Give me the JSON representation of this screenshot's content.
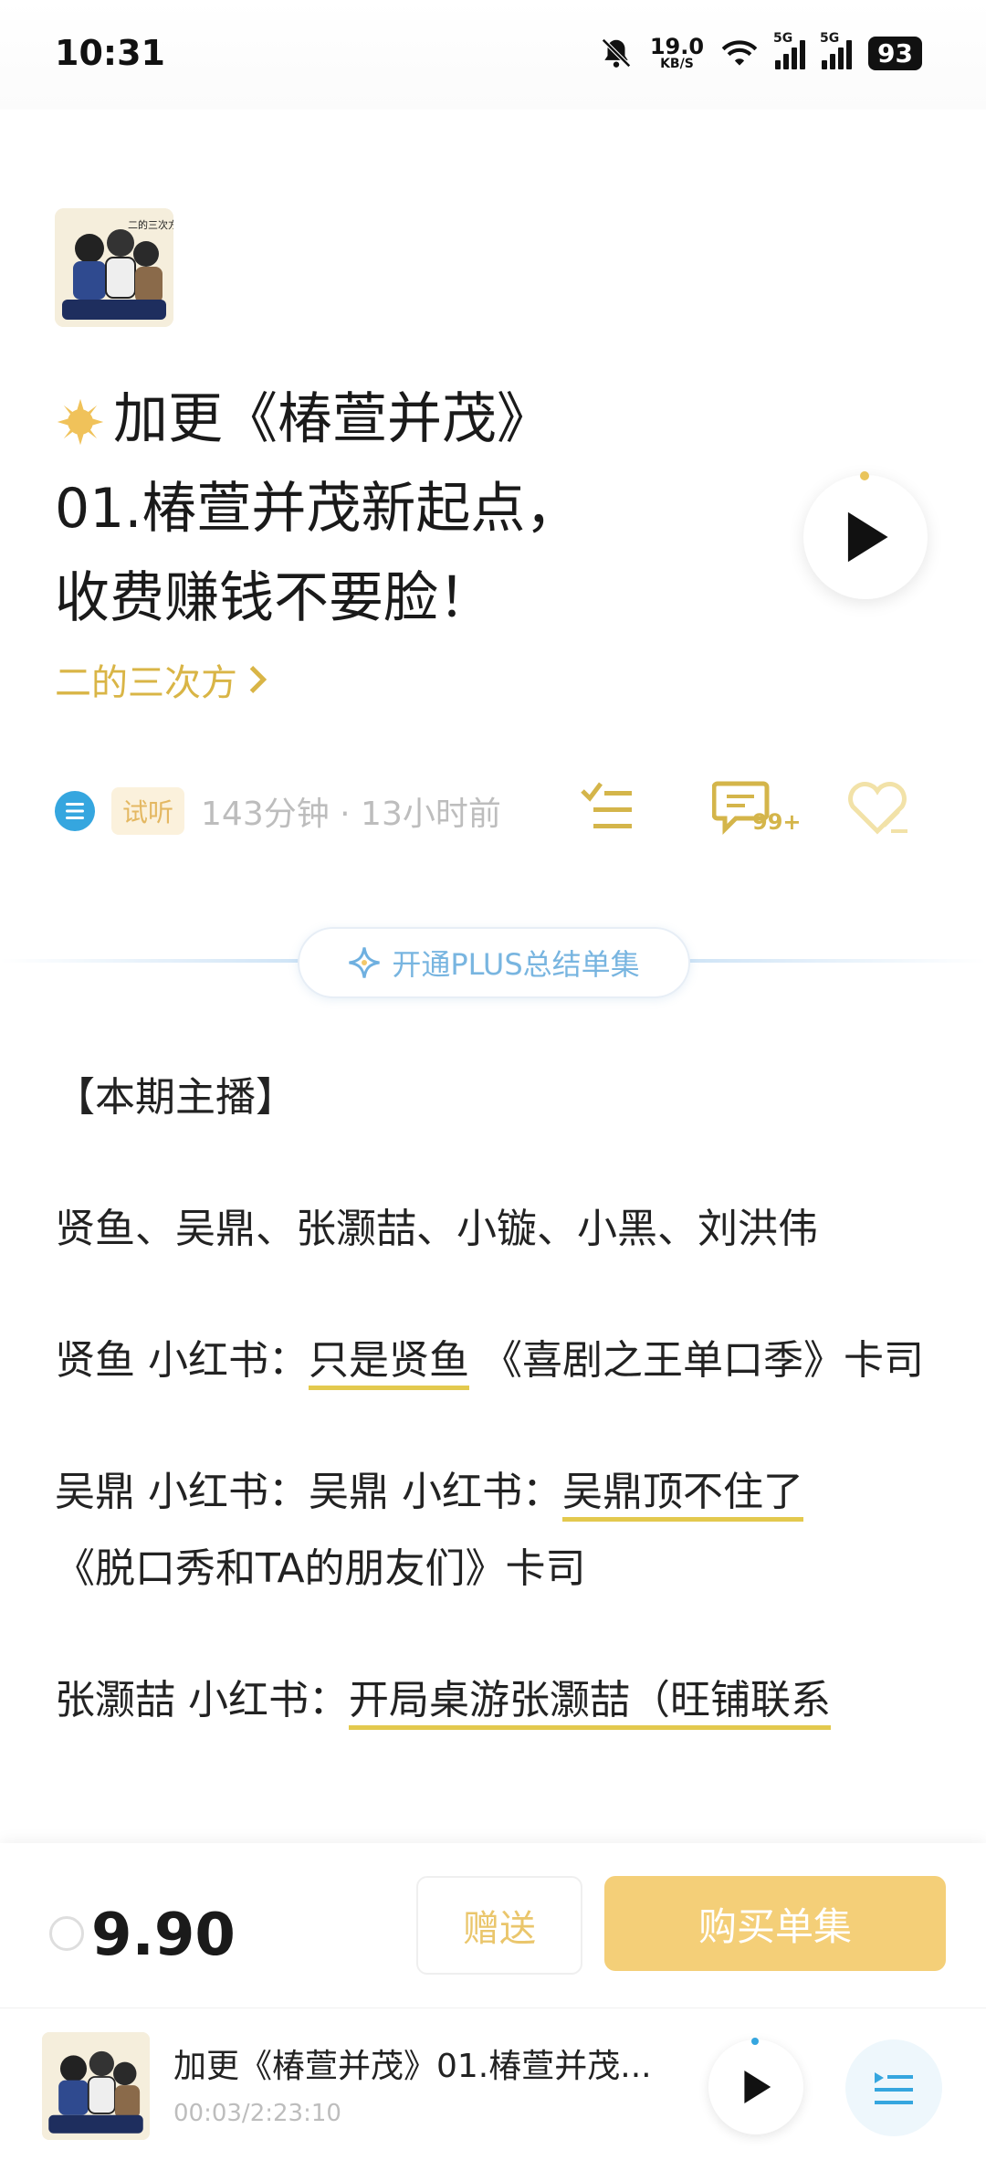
{
  "status_bar": {
    "time": "10:31",
    "net_speed": "19.0",
    "net_unit": "KB/S",
    "sim1": "5G",
    "sim2": "5G",
    "battery": "93"
  },
  "episode": {
    "title_lines": [
      "加更《椿萱并茂》",
      "01.椿萱并茂新起点，",
      "收费赚钱不要脸！"
    ],
    "author": "二的三次方",
    "trial_badge": "试听",
    "meta": "143分钟 · 13小时前",
    "comment_count": "99+",
    "plus_pill": "开通PLUS总结单集"
  },
  "description": {
    "heading": "【本期主播】",
    "hosts": "贤鱼、吴鼎、张灏喆、小镟、小黑、刘洪伟",
    "p1_prefix": "贤鱼 小红书：",
    "p1_link": "只是贤鱼",
    "p1_suffix": "《喜剧之王单口季》卡司",
    "p2_prefix": "吴鼎 小红书：吴鼎 小红书：",
    "p2_link": "吴鼎顶不住了",
    "p2_suffix": "《脱口秀和TA的朋友们》卡司",
    "p3_prefix": "张灏喆 小红书：",
    "p3_link": "开局桌游张灏喆（旺铺联系"
  },
  "purchase": {
    "price": "9.90",
    "gift_label": "赠送",
    "buy_label": "购买单集"
  },
  "mini_player": {
    "title": "加更《椿萱并茂》01.椿萱并茂...",
    "time": "00:03/2:23:10"
  },
  "colors": {
    "accent_gold": "#d9b546",
    "buy_button": "#f4cf78",
    "link_underline": "#e3c94e",
    "blue": "#35a6df"
  }
}
